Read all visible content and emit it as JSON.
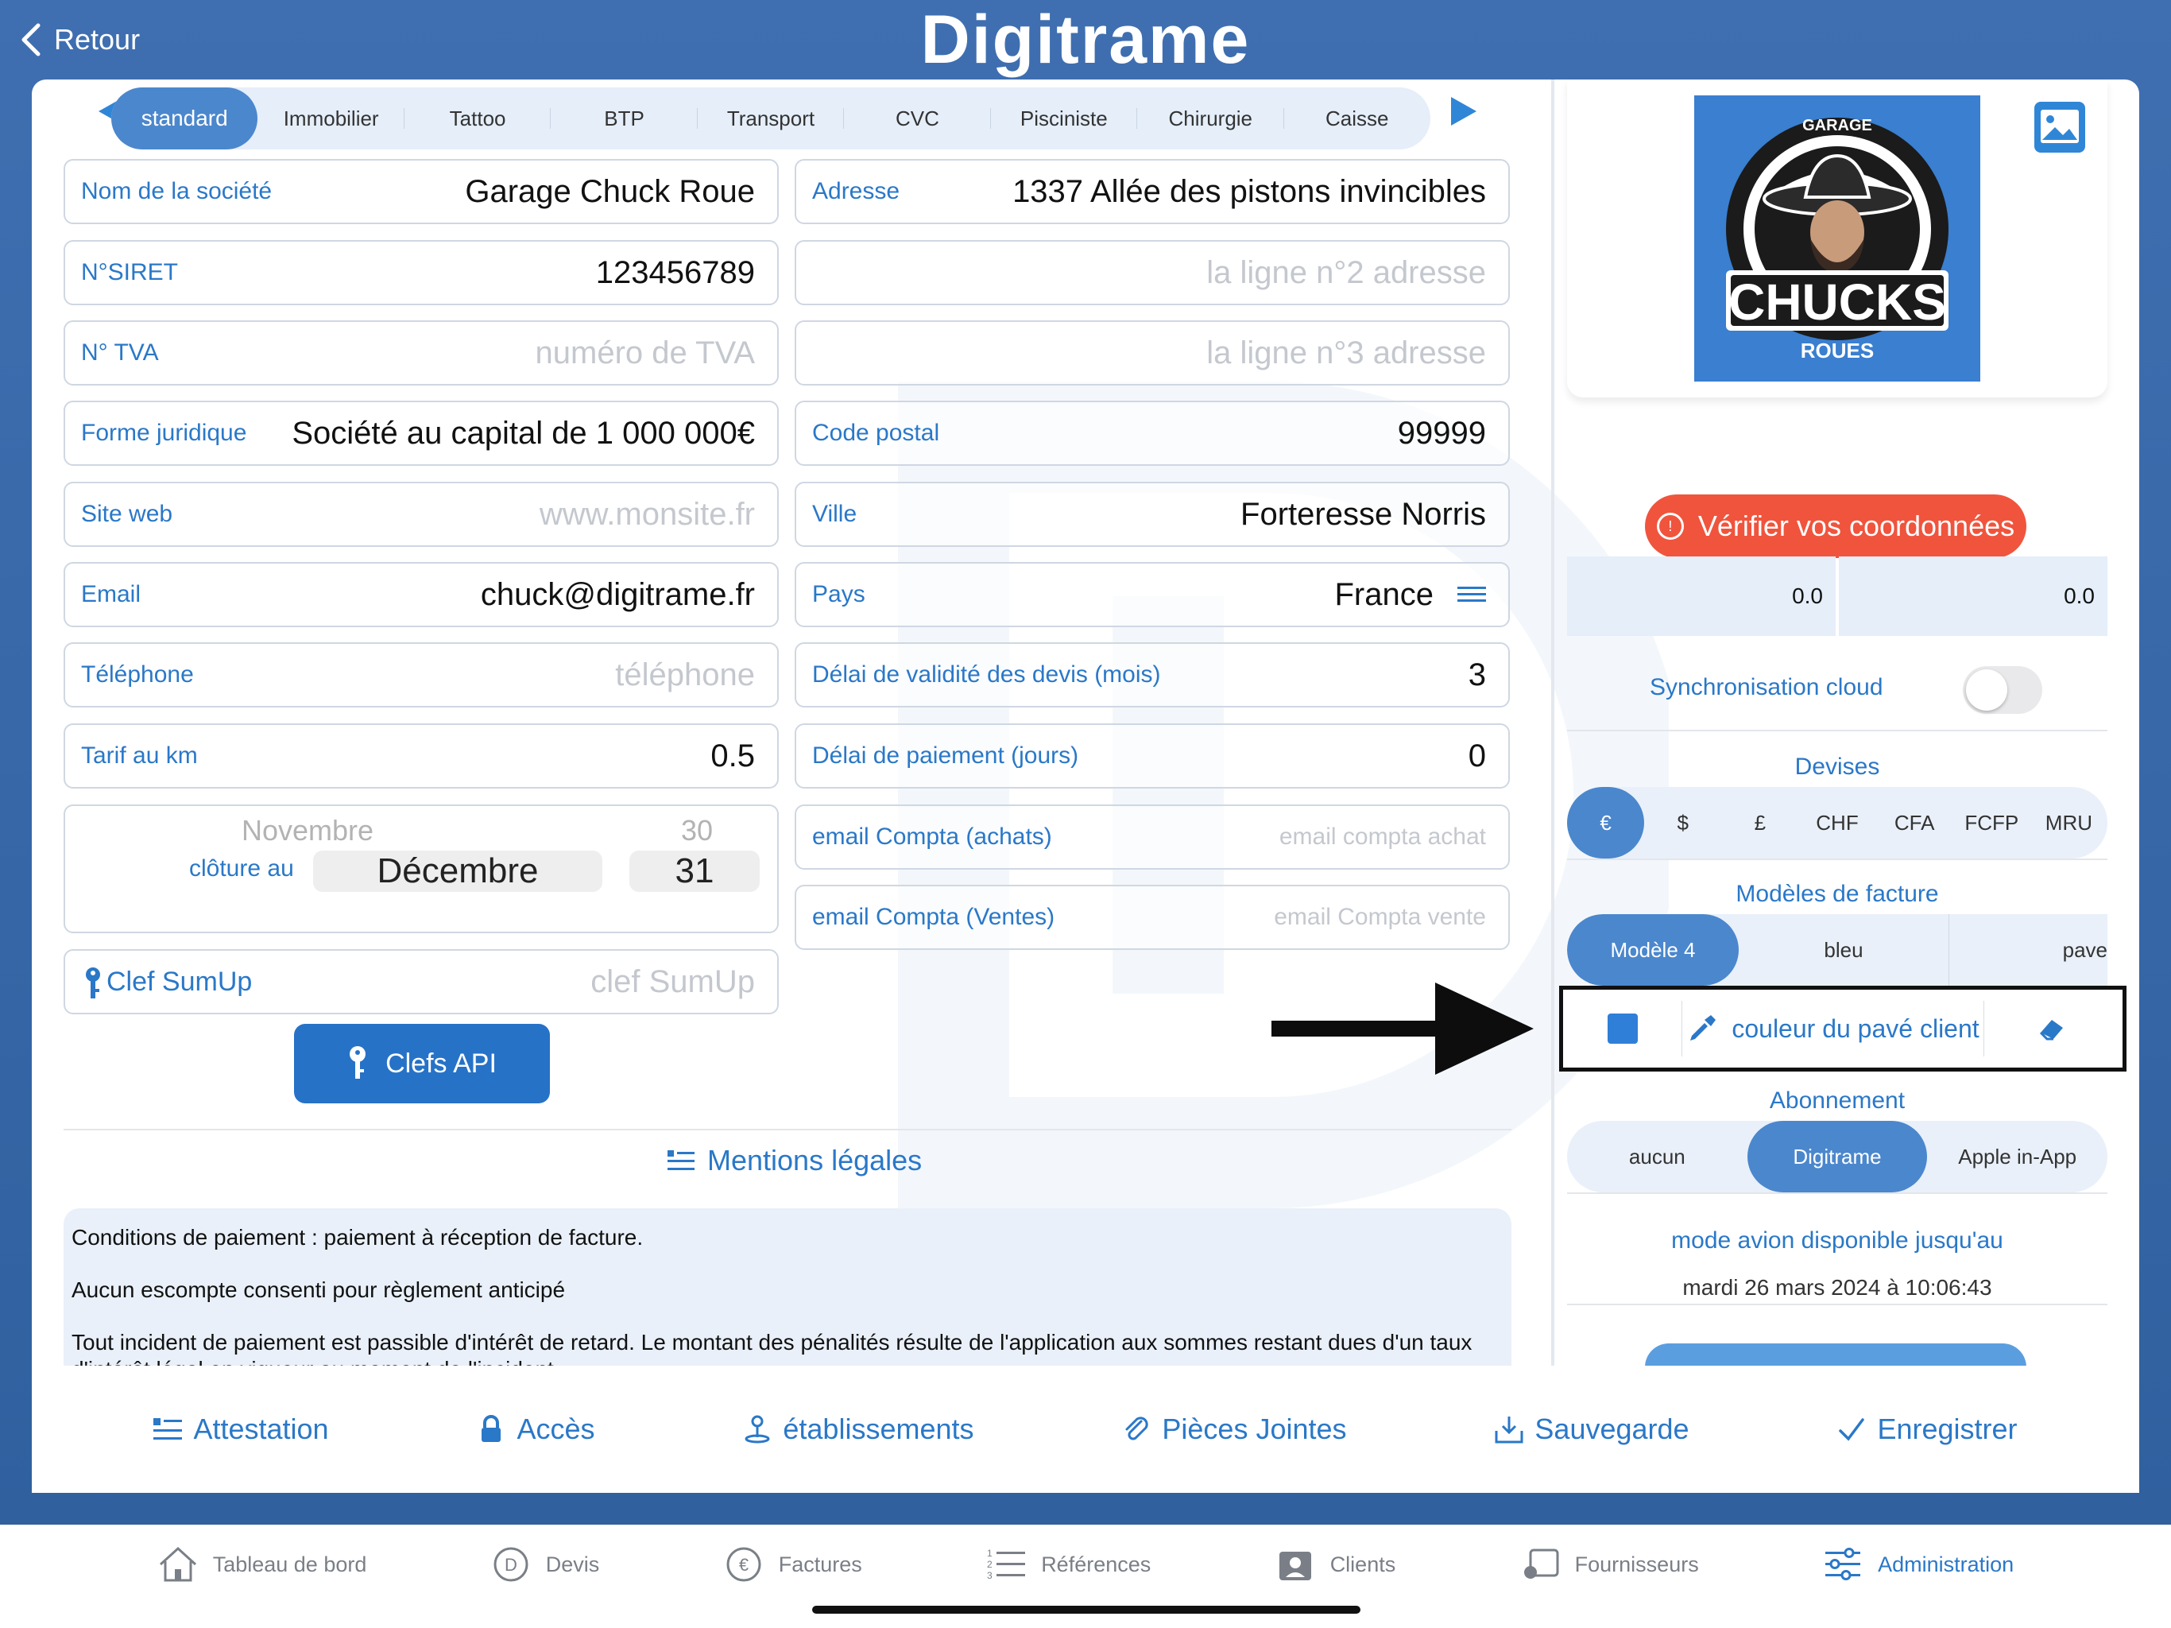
{
  "header": {
    "back_label": "Retour",
    "app_title": "Digitrame"
  },
  "tabs": [
    "standard",
    "Immobilier",
    "Tattoo",
    "BTP",
    "Transport",
    "CVC",
    "Pisciniste",
    "Chirurgie",
    "Caisse"
  ],
  "active_tab": "standard",
  "left_fields": [
    {
      "label": "Nom de la société",
      "value": "Garage Chuck Roue"
    },
    {
      "label": "N°SIRET",
      "value": "123456789"
    },
    {
      "label": "N° TVA",
      "placeholder": "numéro de TVA"
    },
    {
      "label": "Forme juridique",
      "value": "Société au capital de 1 000 000€"
    },
    {
      "label": "Site web",
      "placeholder": "www.monsite.fr"
    },
    {
      "label": "Email",
      "value": "chuck@digitrame.fr"
    },
    {
      "label": "Téléphone",
      "placeholder": "téléphone"
    },
    {
      "label": "Tarif au km",
      "value": "0.5"
    }
  ],
  "right_fields": [
    {
      "label": "Adresse",
      "value": "1337 Allée des pistons invincibles"
    },
    {
      "label": "",
      "placeholder": "la ligne n°2 adresse"
    },
    {
      "label": "",
      "placeholder": "la ligne n°3 adresse"
    },
    {
      "label": "Code postal",
      "value": "99999"
    },
    {
      "label": "Ville",
      "value": "Forteresse Norris"
    },
    {
      "label": "Pays",
      "value": "France"
    },
    {
      "label": "Délai de validité des devis (mois)",
      "value": "3"
    },
    {
      "label": "Délai de paiement (jours)",
      "value": "0"
    },
    {
      "label": "email Compta (achats)",
      "placeholder": "email compta achat"
    },
    {
      "label": "email Compta (Ventes)",
      "placeholder": "email Compta vente"
    }
  ],
  "closing_picker": {
    "label": "clôture au",
    "month_prev": "Novembre",
    "month_selected": "Décembre",
    "day_prev": "30",
    "day_selected": "31"
  },
  "sumup": {
    "label": "Clef SumUp",
    "placeholder": "clef SumUp"
  },
  "api_button": "Clefs API",
  "mentions": {
    "title": "Mentions légales",
    "lines": [
      "Conditions de paiement : paiement à réception de facture.",
      "Aucun escompte consenti pour règlement anticipé",
      "Tout incident de paiement est passible d'intérêt de retard. Le montant des pénalités résulte de l'application aux sommes restant dues d'un taux d'intérêt légal en vigueur au moment de l'incident."
    ]
  },
  "brand_logo": {
    "top_text": "GARAGE",
    "main_text": "CHUCKS",
    "sub_text": "ROUES",
    "bg_color": "#3a7fd0"
  },
  "verify_button": "Vérifier vos coordonnées",
  "coordinates": [
    "0.0",
    "0.0"
  ],
  "sync": {
    "label": "Synchronisation cloud",
    "enabled": false
  },
  "currencies": {
    "title": "Devises",
    "options": [
      "€",
      "$",
      "£",
      "CHF",
      "CFA",
      "FCFP",
      "MRU"
    ],
    "selected": "€"
  },
  "invoice_models": {
    "title": "Modèles de facture",
    "options": [
      "Modèle 4",
      "bleu",
      "pave"
    ],
    "selected": "Modèle 4"
  },
  "client_color": {
    "label": "couleur du pavé client",
    "swatch_color": "#2f7fd8"
  },
  "subscription": {
    "title": "Abonnement",
    "options": [
      "aucun",
      "Digitrame",
      "Apple in-App"
    ],
    "selected": "Digitrame"
  },
  "airplane": {
    "label": "mode avion disponible jusqu'au",
    "date": "mardi 26 mars 2024 à 10:06:43"
  },
  "actions": [
    "Attestation",
    "Accès",
    "établissements",
    "Pièces Jointes",
    "Sauvegarde",
    "Enregistrer"
  ],
  "bottom_nav": {
    "items": [
      "Tableau de bord",
      "Devis",
      "Factures",
      "Références",
      "Clients",
      "Fournisseurs",
      "Administration"
    ],
    "active": "Administration"
  },
  "colors": {
    "accent": "#2a78c8",
    "active_segment": "#4b87cd",
    "verify": "#f0543d",
    "background": "#3f6fb0"
  }
}
